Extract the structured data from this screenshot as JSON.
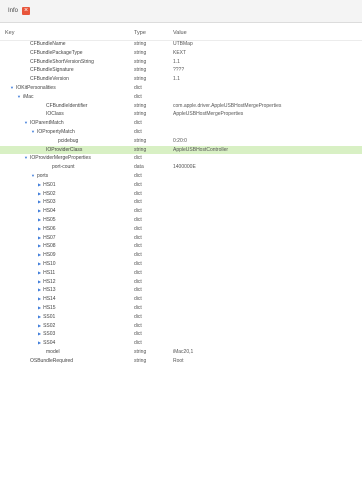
{
  "tab": {
    "label": "Info",
    "close_symbol": "×"
  },
  "header": {
    "key": "Key",
    "type": "Type",
    "value": "Value"
  },
  "rows": [
    {
      "indent": 0,
      "tri": "",
      "key": "CFBundleName",
      "type": "string",
      "value": "UTBMap"
    },
    {
      "indent": 0,
      "tri": "",
      "key": "CFBundlePackageType",
      "type": "string",
      "value": "KEXT"
    },
    {
      "indent": 0,
      "tri": "",
      "key": "CFBundleShortVersionString",
      "type": "string",
      "value": "1.1"
    },
    {
      "indent": 0,
      "tri": "",
      "key": "CFBundleSignature",
      "type": "string",
      "value": "????"
    },
    {
      "indent": 0,
      "tri": "",
      "key": "CFBundleVersion",
      "type": "string",
      "value": "1.1"
    },
    {
      "indent": 0,
      "tri": "open",
      "key": "IOKitPersonalities",
      "type": "dict",
      "value": ""
    },
    {
      "indent": 1,
      "tri": "open",
      "key": "iMac",
      "type": "dict",
      "value": ""
    },
    {
      "indent": 2,
      "tri": "",
      "key": "CFBundleIdentifier",
      "type": "string",
      "value": "com.apple.driver.AppleUSBHostMergeProperties"
    },
    {
      "indent": 2,
      "tri": "",
      "key": "IOClass",
      "type": "string",
      "value": "AppleUSBHostMergeProperties"
    },
    {
      "indent": 2,
      "tri": "open",
      "key": "IOParentMatch",
      "type": "dict",
      "value": ""
    },
    {
      "indent": 3,
      "tri": "open",
      "key": "IOPropertyMatch",
      "type": "dict",
      "value": ""
    },
    {
      "indent": 4,
      "tri": "",
      "key": "pcidebug",
      "type": "string",
      "value": "0:20:0"
    },
    {
      "indent": 2,
      "tri": "",
      "key": "IOProviderClass",
      "type": "string",
      "value": "AppleUSBHostController",
      "sel": true
    },
    {
      "indent": 2,
      "tri": "open",
      "key": "IOProviderMergeProperties",
      "type": "dict",
      "value": ""
    },
    {
      "indent": 3,
      "tri": "",
      "key": "port-count",
      "type": "data",
      "value": "1400000E"
    },
    {
      "indent": 3,
      "tri": "open",
      "key": "ports",
      "type": "dict",
      "value": ""
    },
    {
      "indent": 4,
      "tri": "closed",
      "key": "HS01",
      "type": "dict",
      "value": ""
    },
    {
      "indent": 4,
      "tri": "closed",
      "key": "HS02",
      "type": "dict",
      "value": ""
    },
    {
      "indent": 4,
      "tri": "closed",
      "key": "HS03",
      "type": "dict",
      "value": ""
    },
    {
      "indent": 4,
      "tri": "closed",
      "key": "HS04",
      "type": "dict",
      "value": ""
    },
    {
      "indent": 4,
      "tri": "closed",
      "key": "HS05",
      "type": "dict",
      "value": ""
    },
    {
      "indent": 4,
      "tri": "closed",
      "key": "HS06",
      "type": "dict",
      "value": ""
    },
    {
      "indent": 4,
      "tri": "closed",
      "key": "HS07",
      "type": "dict",
      "value": ""
    },
    {
      "indent": 4,
      "tri": "closed",
      "key": "HS08",
      "type": "dict",
      "value": ""
    },
    {
      "indent": 4,
      "tri": "closed",
      "key": "HS09",
      "type": "dict",
      "value": ""
    },
    {
      "indent": 4,
      "tri": "closed",
      "key": "HS10",
      "type": "dict",
      "value": ""
    },
    {
      "indent": 4,
      "tri": "closed",
      "key": "HS11",
      "type": "dict",
      "value": ""
    },
    {
      "indent": 4,
      "tri": "closed",
      "key": "HS12",
      "type": "dict",
      "value": ""
    },
    {
      "indent": 4,
      "tri": "closed",
      "key": "HS13",
      "type": "dict",
      "value": ""
    },
    {
      "indent": 4,
      "tri": "closed",
      "key": "HS14",
      "type": "dict",
      "value": ""
    },
    {
      "indent": 4,
      "tri": "closed",
      "key": "HS15",
      "type": "dict",
      "value": ""
    },
    {
      "indent": 4,
      "tri": "closed",
      "key": "SS01",
      "type": "dict",
      "value": ""
    },
    {
      "indent": 4,
      "tri": "closed",
      "key": "SS02",
      "type": "dict",
      "value": ""
    },
    {
      "indent": 4,
      "tri": "closed",
      "key": "SS03",
      "type": "dict",
      "value": ""
    },
    {
      "indent": 4,
      "tri": "closed",
      "key": "SS04",
      "type": "dict",
      "value": ""
    },
    {
      "indent": 2,
      "tri": "",
      "key": "model",
      "type": "string",
      "value": "iMac20,1"
    },
    {
      "indent": 0,
      "tri": "",
      "key": "OSBundleRequired",
      "type": "string",
      "value": "Root"
    }
  ]
}
